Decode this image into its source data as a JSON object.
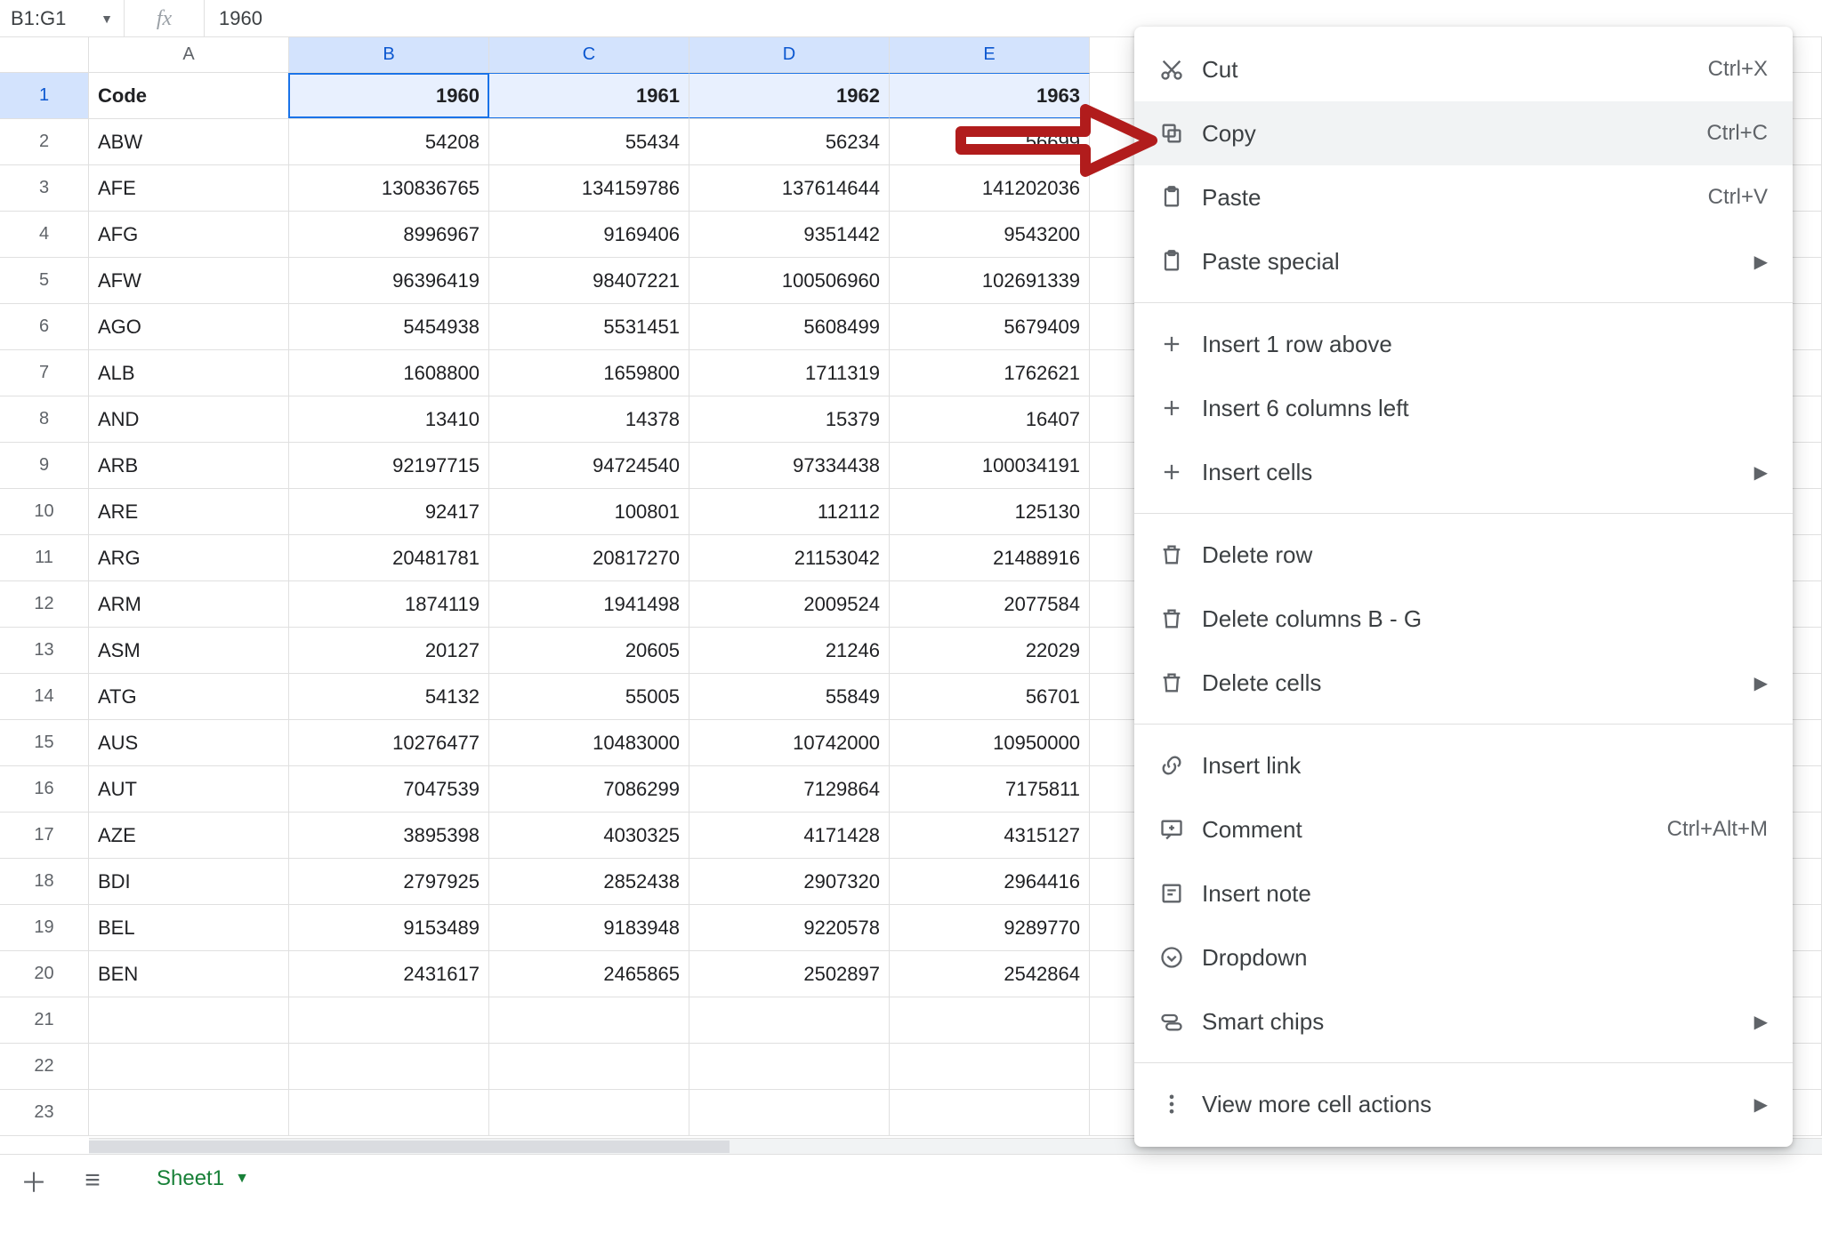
{
  "formula_bar": {
    "name_box": "B1:G1",
    "fx": "fx",
    "value": "1960"
  },
  "columns": [
    "A",
    "B",
    "C",
    "D",
    "E"
  ],
  "row_numbers": [
    1,
    2,
    3,
    4,
    5,
    6,
    7,
    8,
    9,
    10,
    11,
    12,
    13,
    14,
    15,
    16,
    17,
    18,
    19,
    20,
    21,
    22,
    23
  ],
  "header_row": {
    "A": "Code",
    "B": "1960",
    "C": "1961",
    "D": "1962",
    "E": "1963"
  },
  "rows": [
    {
      "A": "ABW",
      "B": "54208",
      "C": "55434",
      "D": "56234",
      "E": "56699"
    },
    {
      "A": "AFE",
      "B": "130836765",
      "C": "134159786",
      "D": "137614644",
      "E": "141202036"
    },
    {
      "A": "AFG",
      "B": "8996967",
      "C": "9169406",
      "D": "9351442",
      "E": "9543200"
    },
    {
      "A": "AFW",
      "B": "96396419",
      "C": "98407221",
      "D": "100506960",
      "E": "102691339"
    },
    {
      "A": "AGO",
      "B": "5454938",
      "C": "5531451",
      "D": "5608499",
      "E": "5679409"
    },
    {
      "A": "ALB",
      "B": "1608800",
      "C": "1659800",
      "D": "1711319",
      "E": "1762621"
    },
    {
      "A": "AND",
      "B": "13410",
      "C": "14378",
      "D": "15379",
      "E": "16407"
    },
    {
      "A": "ARB",
      "B": "92197715",
      "C": "94724540",
      "D": "97334438",
      "E": "100034191"
    },
    {
      "A": "ARE",
      "B": "92417",
      "C": "100801",
      "D": "112112",
      "E": "125130"
    },
    {
      "A": "ARG",
      "B": "20481781",
      "C": "20817270",
      "D": "21153042",
      "E": "21488916"
    },
    {
      "A": "ARM",
      "B": "1874119",
      "C": "1941498",
      "D": "2009524",
      "E": "2077584"
    },
    {
      "A": "ASM",
      "B": "20127",
      "C": "20605",
      "D": "21246",
      "E": "22029"
    },
    {
      "A": "ATG",
      "B": "54132",
      "C": "55005",
      "D": "55849",
      "E": "56701"
    },
    {
      "A": "AUS",
      "B": "10276477",
      "C": "10483000",
      "D": "10742000",
      "E": "10950000"
    },
    {
      "A": "AUT",
      "B": "7047539",
      "C": "7086299",
      "D": "7129864",
      "E": "7175811"
    },
    {
      "A": "AZE",
      "B": "3895398",
      "C": "4030325",
      "D": "4171428",
      "E": "4315127"
    },
    {
      "A": "BDI",
      "B": "2797925",
      "C": "2852438",
      "D": "2907320",
      "E": "2964416"
    },
    {
      "A": "BEL",
      "B": "9153489",
      "C": "9183948",
      "D": "9220578",
      "E": "9289770"
    },
    {
      "A": "BEN",
      "B": "2431617",
      "C": "2465865",
      "D": "2502897",
      "E": "2542864"
    }
  ],
  "context_menu": {
    "items": [
      {
        "icon": "cut",
        "label": "Cut",
        "shortcut": "Ctrl+X"
      },
      {
        "icon": "copy",
        "label": "Copy",
        "shortcut": "Ctrl+C",
        "hover": true
      },
      {
        "icon": "paste",
        "label": "Paste",
        "shortcut": "Ctrl+V"
      },
      {
        "icon": "paste",
        "label": "Paste special",
        "submenu": true
      },
      {
        "sep": true
      },
      {
        "icon": "plus",
        "label": "Insert 1 row above"
      },
      {
        "icon": "plus",
        "label": "Insert 6 columns left"
      },
      {
        "icon": "plus",
        "label": "Insert cells",
        "submenu": true
      },
      {
        "sep": true
      },
      {
        "icon": "trash",
        "label": "Delete row"
      },
      {
        "icon": "trash",
        "label": "Delete columns B - G"
      },
      {
        "icon": "trash",
        "label": "Delete cells",
        "submenu": true
      },
      {
        "sep": true
      },
      {
        "icon": "link",
        "label": "Insert link"
      },
      {
        "icon": "comment",
        "label": "Comment",
        "shortcut": "Ctrl+Alt+M"
      },
      {
        "icon": "note",
        "label": "Insert note"
      },
      {
        "icon": "dropdown",
        "label": "Dropdown"
      },
      {
        "icon": "chips",
        "label": "Smart chips",
        "submenu": true
      },
      {
        "sep": true
      },
      {
        "icon": "more",
        "label": "View more cell actions",
        "submenu": true
      }
    ]
  },
  "tabs": {
    "sheet_name": "Sheet1",
    "add_tooltip": "+",
    "all_sheets_tooltip": "≡"
  }
}
